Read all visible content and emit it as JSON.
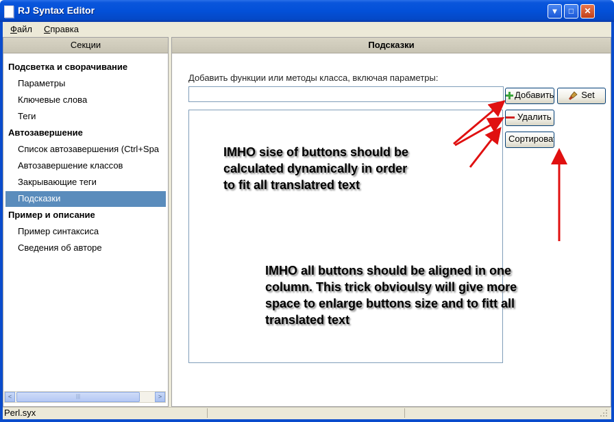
{
  "window": {
    "title": "RJ Syntax Editor",
    "controls": {
      "minimize": "▾",
      "maximize": "□",
      "close": "✕"
    }
  },
  "menu": {
    "items": [
      {
        "label": "Файл",
        "underline": "Ф"
      },
      {
        "label": "Справка",
        "underline": "С"
      }
    ]
  },
  "sections_panel": {
    "header": "Секции",
    "groups": [
      {
        "title": "Подсветка и сворачивание",
        "items": [
          "Параметры",
          "Ключевые слова",
          "Теги"
        ]
      },
      {
        "title": "Автозавершение",
        "items": [
          "Список автозавершения (Ctrl+Spa",
          "Автозавершение классов",
          "Закрывающие теги",
          "Подсказки"
        ]
      },
      {
        "title": "Пример и описание",
        "items": [
          "Пример синтаксиса",
          "Сведения об авторе"
        ]
      }
    ],
    "selected_item": "Подсказки",
    "scrollbar": {
      "left": "<",
      "right": ">",
      "thumb": "|||"
    }
  },
  "hints_panel": {
    "header": "Подсказки",
    "input_label": "Добавить функции или методы класса, включая параметры:",
    "input_value": "",
    "buttons": {
      "add": "Добавить",
      "set": "Set",
      "delete": "Удалить",
      "sort": "Сортировать"
    }
  },
  "annotations": {
    "note1": [
      "IMHO sise of buttons should be",
      "calculated dynamically in order",
      "to fit all translatred text"
    ],
    "note2": [
      "IMHO all buttons should be aligned in one",
      "column. This trick obvioulsy will give more",
      "space to enlarge buttons size and to fitt all",
      "translated text"
    ]
  },
  "colors": {
    "titlebar": "#0a56dc",
    "selection": "#5a8cbc",
    "arrow": "#e01010",
    "input_border": "#7f9db9"
  },
  "status": {
    "file": "Perl.syx"
  }
}
